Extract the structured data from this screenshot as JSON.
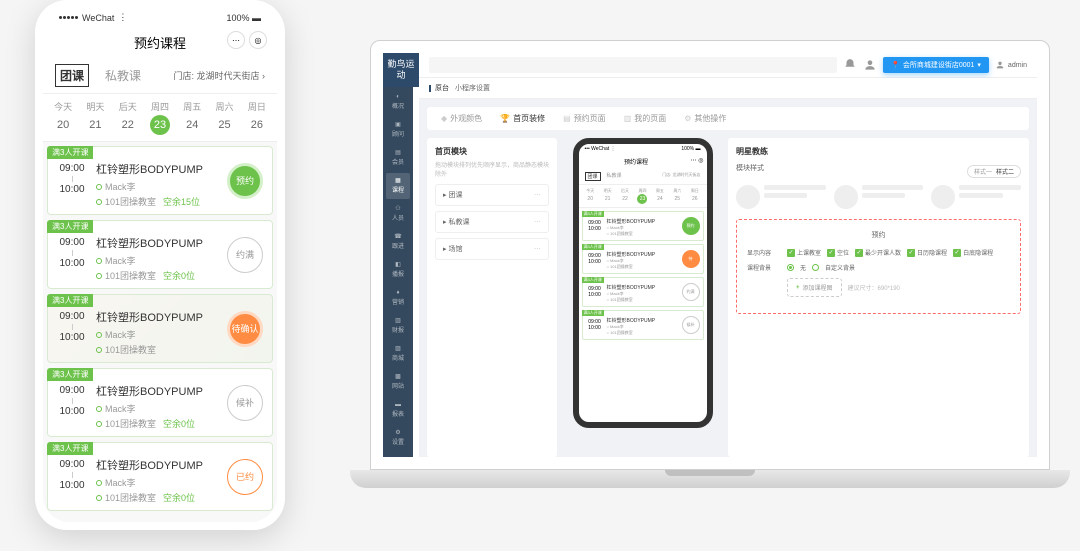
{
  "phone": {
    "status": {
      "carrier": "WeChat",
      "battery": "100%"
    },
    "title": "预约课程",
    "tabs": {
      "group": "团课",
      "private": "私教课",
      "store": "门店: 龙湖时代天街店"
    },
    "calendar": [
      {
        "name": "今天",
        "num": "20"
      },
      {
        "name": "明天",
        "num": "21"
      },
      {
        "name": "后天",
        "num": "22"
      },
      {
        "name": "周四",
        "num": "23",
        "active": true
      },
      {
        "name": "周五",
        "num": "24"
      },
      {
        "name": "周六",
        "num": "25"
      },
      {
        "name": "周日",
        "num": "26"
      }
    ],
    "classes": [
      {
        "badge": "满3人开课",
        "start": "09:00",
        "end": "10:00",
        "name": "杠铃塑形BODYPUMP",
        "coach": "Mack李",
        "room": "101团操教室",
        "seats": "空余15位",
        "action": "预约",
        "style": "green"
      },
      {
        "badge": "满3人开课",
        "start": "09:00",
        "end": "10:00",
        "name": "杠铃塑形BODYPUMP",
        "coach": "Mack李",
        "room": "101团操教室",
        "seats": "空余0位",
        "action": "约满",
        "style": "gray"
      },
      {
        "badge": "满3人开课",
        "start": "09:00",
        "end": "10:00",
        "name": "杠铃塑形BODYPUMP",
        "coach": "Mack李",
        "room": "101团操教室",
        "seats": "",
        "action": "待确认",
        "style": "orange",
        "bg": true
      },
      {
        "badge": "满3人开课",
        "start": "09:00",
        "end": "10:00",
        "name": "杠铃塑形BODYPUMP",
        "coach": "Mack李",
        "room": "101团操教室",
        "seats": "空余0位",
        "action": "候补",
        "style": "gray"
      },
      {
        "badge": "满3人开课",
        "start": "09:00",
        "end": "10:00",
        "name": "杠铃塑形BODYPUMP",
        "coach": "Mack李",
        "room": "101团操教室",
        "seats": "空余0位",
        "action": "已约",
        "style": "orange-outline"
      }
    ]
  },
  "laptop": {
    "logo": "勤鸟运动",
    "sidebar": [
      "概况",
      "顾问",
      "会员",
      "课程",
      "人员",
      "跟进",
      "播报",
      "营销",
      "财报",
      "商城",
      "网站",
      "报表",
      "设置"
    ],
    "sidebar_active": 3,
    "location": "会所商城建设街店0001",
    "admin": "admin",
    "breadcrumb": {
      "root": "原台",
      "page": "小程序设置"
    },
    "tabs": [
      {
        "label": "外观颜色"
      },
      {
        "label": "首页装修",
        "active": true
      },
      {
        "label": "预约页面"
      },
      {
        "label": "我的页面"
      },
      {
        "label": "其他操作"
      }
    ],
    "left_panel": {
      "title": "首页模块",
      "sub": "拖动模块排列优先顺序显示，商品静态模块除外",
      "items": [
        "团课",
        "私教课",
        "场馆"
      ]
    },
    "preview": {
      "title": "预约课程",
      "tabs": {
        "group": "团课",
        "private": "私教课",
        "store": "门店: 龙湖时代天街店"
      },
      "cal": [
        "20",
        "21",
        "22",
        "23",
        "24",
        "25",
        "26"
      ],
      "cards": [
        {
          "name": "杠铃塑形BODYPUMP",
          "coach": "Mack李",
          "room": "101团操教室",
          "style": "green",
          "action": "预约"
        },
        {
          "name": "杠铃塑形BODYPUMP",
          "coach": "Mack李",
          "room": "101团操教室",
          "style": "orange",
          "action": "待"
        },
        {
          "name": "杠铃塑形BODYPUMP",
          "coach": "Mack李",
          "room": "101团操教室",
          "style": "gray",
          "action": "约满"
        },
        {
          "name": "杠铃塑形BODYPUMP",
          "coach": "Mack李",
          "room": "101团操教室",
          "style": "gray",
          "action": "候补"
        }
      ]
    },
    "right_panel": {
      "coach_title": "明星教练",
      "style_label": "模块样式",
      "style_opts": {
        "a": "样式一",
        "b": "样式二"
      },
      "booking": {
        "title": "预约",
        "display_label": "显示内容",
        "display_opts": [
          "上课教室",
          "空位",
          "最少开课人数",
          "日历隐课程",
          "白底隐课程"
        ],
        "bg_label": "课程背景",
        "bg_opts": [
          "无",
          "自定义背景"
        ],
        "add": "添加课程图",
        "add_hint": "建议尺寸：690*190"
      }
    }
  }
}
